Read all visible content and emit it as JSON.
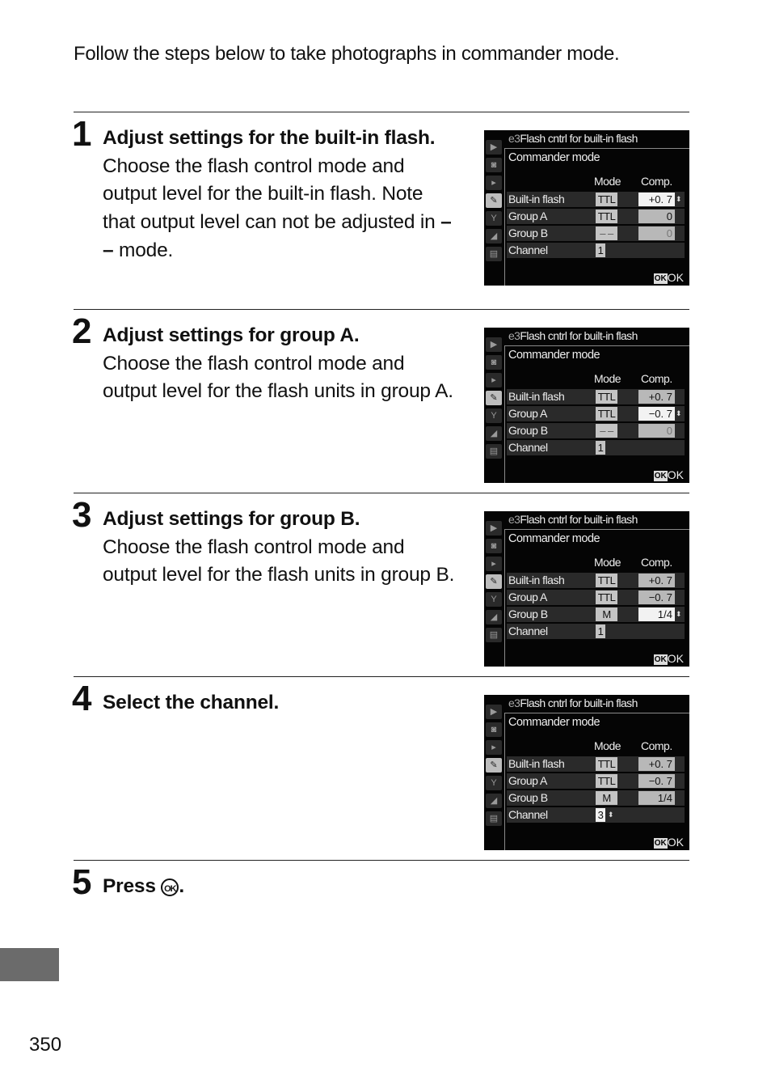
{
  "intro": "Follow the steps below to take photographs in commander mode.",
  "steps": [
    {
      "number": "1",
      "title": "Adjust settings for the built-in flash.",
      "body_before": "Choose the flash control mode and output level for the built-in flash. Note that output level can not be adjusted in ",
      "body_strong": "– –",
      "body_after": " mode.",
      "screen": {
        "title_code": "e3",
        "title": "Flash cntrl for built-in flash",
        "subtitle": "Commander mode",
        "col_mode": "Mode",
        "col_comp": "Comp.",
        "rows": [
          {
            "label": "Built-in flash",
            "mode": "TTL",
            "comp": "+0. 7",
            "selected": "comp"
          },
          {
            "label": "Group A",
            "mode": "TTL",
            "comp": "0"
          },
          {
            "label": "Group B",
            "mode": "– –",
            "comp": "0",
            "dim": true
          },
          {
            "label": "Channel",
            "mode": "1"
          }
        ],
        "ok_icon": "OK",
        "ok_label": "OK"
      }
    },
    {
      "number": "2",
      "title": "Adjust settings for group A.",
      "body": "Choose the flash control mode and output level for the flash units in group A.",
      "screen": {
        "title_code": "e3",
        "title": "Flash cntrl for built-in flash",
        "subtitle": "Commander mode",
        "col_mode": "Mode",
        "col_comp": "Comp.",
        "rows": [
          {
            "label": "Built-in flash",
            "mode": "TTL",
            "comp": "+0. 7"
          },
          {
            "label": "Group A",
            "mode": "TTL",
            "comp": "−0. 7",
            "selected": "comp"
          },
          {
            "label": "Group B",
            "mode": "– –",
            "comp": "0",
            "dim": true
          },
          {
            "label": "Channel",
            "mode": "1"
          }
        ],
        "ok_icon": "OK",
        "ok_label": "OK"
      }
    },
    {
      "number": "3",
      "title": "Adjust settings for group B.",
      "body": "Choose the flash control mode and output level for the flash units in group B.",
      "screen": {
        "title_code": "e3",
        "title": "Flash cntrl for built-in flash",
        "subtitle": "Commander mode",
        "col_mode": "Mode",
        "col_comp": "Comp.",
        "rows": [
          {
            "label": "Built-in flash",
            "mode": "TTL",
            "comp": "+0. 7"
          },
          {
            "label": "Group A",
            "mode": "TTL",
            "comp": "−0. 7"
          },
          {
            "label": "Group B",
            "mode": "M",
            "comp": "1/4",
            "selected": "comp"
          },
          {
            "label": "Channel",
            "mode": "1"
          }
        ],
        "ok_icon": "OK",
        "ok_label": "OK"
      }
    },
    {
      "number": "4",
      "title": "Select the channel.",
      "screen": {
        "title_code": "e3",
        "title": "Flash cntrl for built-in flash",
        "subtitle": "Commander mode",
        "col_mode": "Mode",
        "col_comp": "Comp.",
        "rows": [
          {
            "label": "Built-in flash",
            "mode": "TTL",
            "comp": "+0. 7"
          },
          {
            "label": "Group A",
            "mode": "TTL",
            "comp": "−0. 7"
          },
          {
            "label": "Group B",
            "mode": "M",
            "comp": "1/4"
          },
          {
            "label": "Channel",
            "mode": "3",
            "selected": "mode"
          }
        ],
        "ok_icon": "OK",
        "ok_label": "OK"
      }
    },
    {
      "number": "5",
      "title_before": "Press ",
      "title_icon": "OK",
      "title_after": "."
    }
  ],
  "sidebar_icons": [
    "playback-icon",
    "camera-icon",
    "movie-icon",
    "pencil-icon",
    "wrench-icon",
    "retouch-icon",
    "my-menu-icon"
  ],
  "sidebar_glyphs": [
    "▶",
    "◙",
    "▸",
    "✎",
    "Y",
    "◢",
    "▤"
  ],
  "selector_arrow": "⬍",
  "page_number": "350",
  "colors": {
    "tab_marker": "#6b6b6b",
    "screen_bg": "#050505"
  }
}
